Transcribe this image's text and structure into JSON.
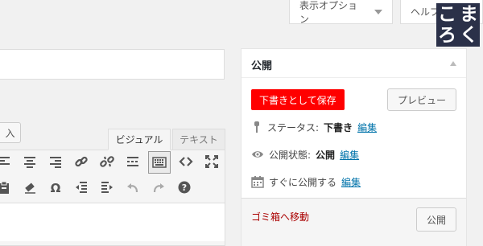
{
  "screen_meta": {
    "display_options_label": "表示オプション",
    "help_label": "ヘルプ"
  },
  "brand": {
    "chars": [
      "こ",
      "ま",
      "ろ",
      "く"
    ]
  },
  "media_button_label": "入",
  "editor": {
    "tabs": [
      {
        "label": "ビジュアル",
        "active": true
      },
      {
        "label": "テキスト",
        "active": false
      }
    ],
    "toolbar_row1": [
      "align-left-icon",
      "align-center-icon",
      "align-right-icon",
      "link-icon",
      "unlink-icon",
      "read-more-icon",
      "toolbar-toggle-icon",
      "code-icon",
      "fullscreen-icon"
    ],
    "toolbar_row2": [
      "paste-text-icon",
      "clear-formatting-icon",
      "special-character-icon",
      "outdent-icon",
      "indent-icon",
      "undo-icon",
      "redo-icon",
      "help-icon"
    ]
  },
  "publish_box": {
    "title": "公開",
    "save_draft_label": "下書きとして保存",
    "preview_label": "プレビュー",
    "status_label": "ステータス:",
    "status_value": "下書き",
    "visibility_label": "公開状態:",
    "visibility_value": "公開",
    "schedule_label": "すぐに公開する",
    "edit_label": "編集",
    "trash_label": "ゴミ箱へ移動",
    "publish_label": "公開"
  },
  "colors": {
    "accent_save": "#ff0000",
    "link": "#0073aa",
    "trash": "#aa0000",
    "brand_bg": "#2b3149"
  }
}
